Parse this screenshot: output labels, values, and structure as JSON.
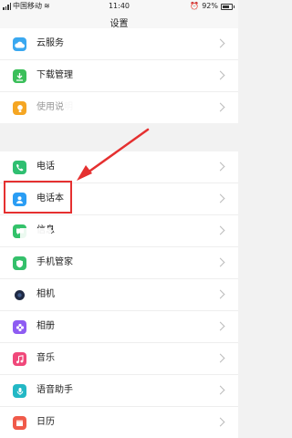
{
  "status_bar": {
    "carrier": "中国移动",
    "time": "11:40",
    "battery": "92%"
  },
  "title": "设置",
  "groups": [
    {
      "items": [
        {
          "label": "云服务",
          "icon": "cloud-icon",
          "color": "#3aa8f0"
        },
        {
          "label": "下载管理",
          "icon": "download-icon",
          "color": "#3bbf5a"
        },
        {
          "label": "使用说明",
          "icon": "bulb-icon",
          "color": "#f5a623"
        }
      ]
    },
    {
      "items": [
        {
          "label": "电话",
          "icon": "phone-icon",
          "color": "#2fbf71"
        },
        {
          "label": "电话本",
          "icon": "contacts-icon",
          "color": "#2a9df4"
        },
        {
          "label": "信息",
          "icon": "message-icon",
          "color": "#33c26a"
        },
        {
          "label": "手机管家",
          "icon": "shield-icon",
          "color": "#34c06b"
        },
        {
          "label": "相机",
          "icon": "camera-icon",
          "color": "#1f2a44"
        },
        {
          "label": "相册",
          "icon": "flower-icon",
          "color": "#8e5cf2"
        },
        {
          "label": "音乐",
          "icon": "music-icon",
          "color": "#f0487a"
        },
        {
          "label": "语音助手",
          "icon": "mic-icon",
          "color": "#23b8c5"
        },
        {
          "label": "日历",
          "icon": "calendar-icon",
          "color": "#f05a4a"
        }
      ]
    }
  ],
  "colors": {
    "highlight": "#e53030",
    "background": "#f2f2f2"
  }
}
